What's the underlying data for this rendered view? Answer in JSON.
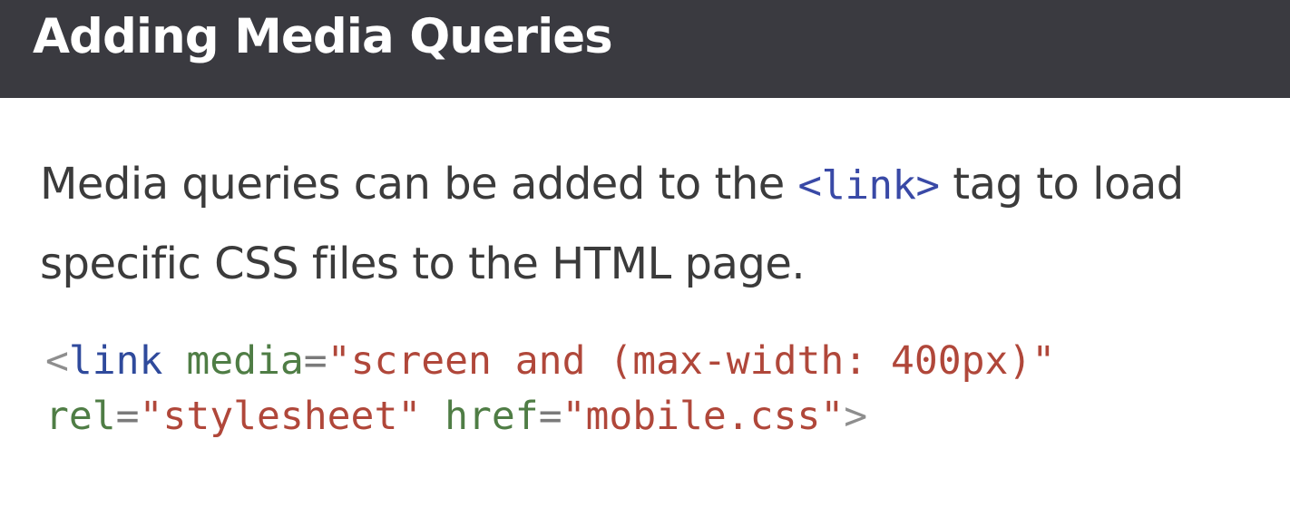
{
  "header": {
    "title": "Adding Media Queries",
    "background_color": "#3a3a40"
  },
  "body": {
    "text_before": "Media queries can be added to the ",
    "inline_code": "<link>",
    "text_after": " tag to load specific CSS files to the HTML page."
  },
  "code": {
    "line1": {
      "open_bracket": "<",
      "tag": "link",
      "space": " ",
      "attr1_name": "media",
      "eq1": "=",
      "attr1_value": "\"screen and (max-width: 400px)\""
    },
    "line2": {
      "attr2_name": "rel",
      "eq2": "=",
      "attr2_value": "\"stylesheet\"",
      "space": " ",
      "attr3_name": "href",
      "eq3": "=",
      "attr3_value": "\"mobile.css\"",
      "close_bracket": ">"
    },
    "colors": {
      "tag": "#2f4a9c",
      "attribute": "#4f7d45",
      "string": "#b0473a",
      "punctuation": "#8e8e8e"
    }
  }
}
